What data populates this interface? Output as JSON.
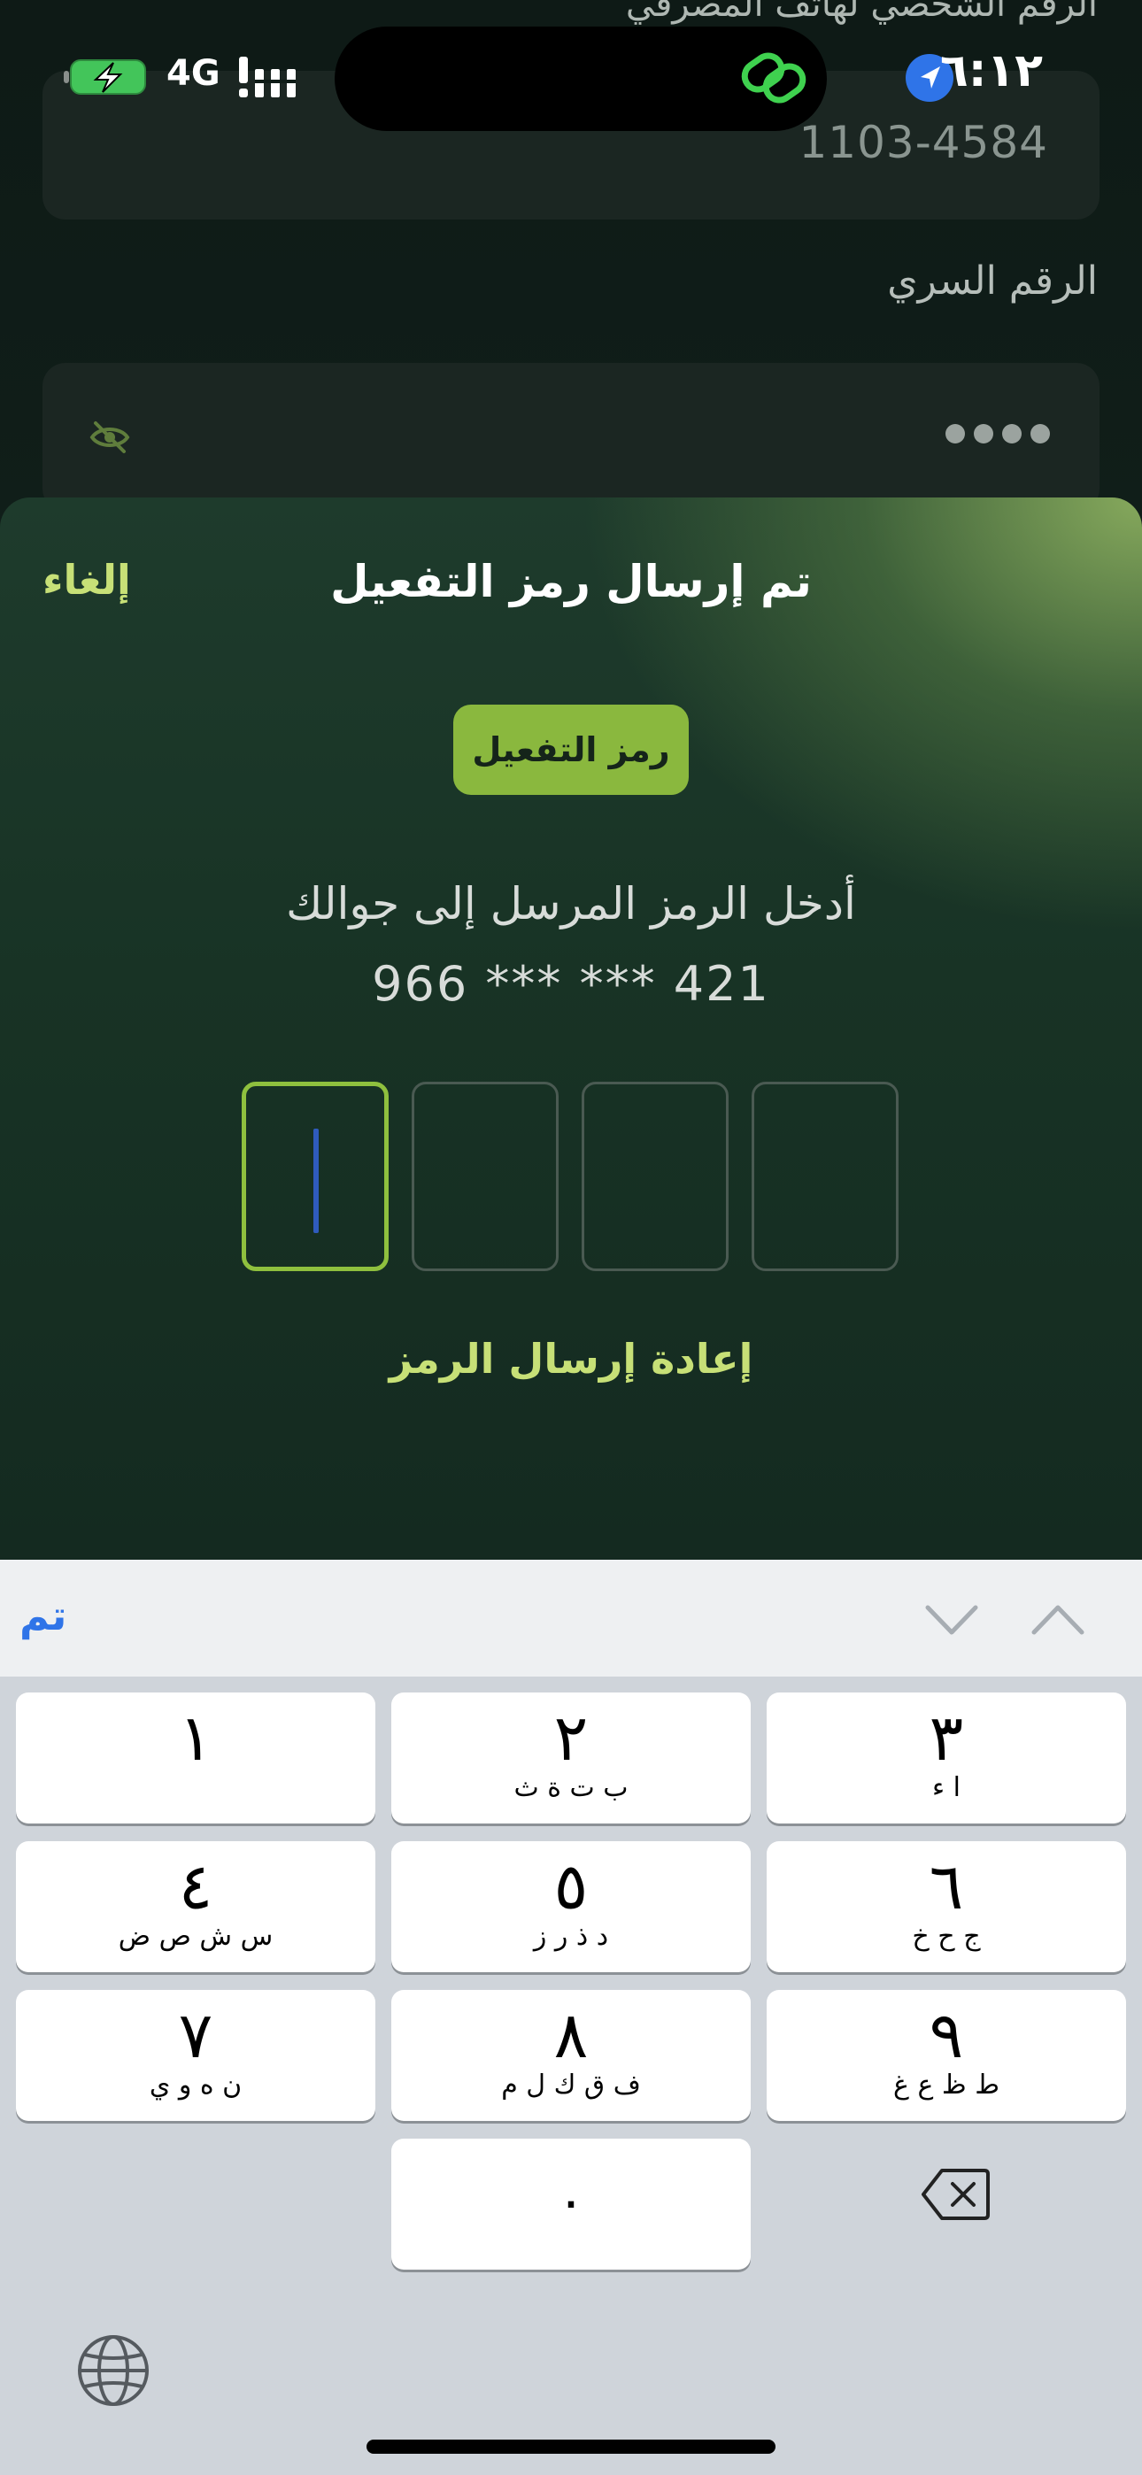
{
  "status_bar": {
    "time": "٦:١٢",
    "network": "4G"
  },
  "background_form": {
    "top_label": "الرقم الشخصي لهاتف المصرفي",
    "account_value": "1103-4584",
    "pin_label": "الرقم السري",
    "pin_dots_count": 4
  },
  "sheet": {
    "title": "تم إرسال رمز التفعيل",
    "cancel_label": "إلغاء",
    "badge_label": "رمز التفعيل",
    "instruction": "أدخل الرمز المرسل إلى جوالك",
    "masked_phone": "966 *** *** 421",
    "otp_box_count": 4,
    "resend_label": "إعادة إرسال الرمز",
    "accent_color": "#8ab83e"
  },
  "keyboard": {
    "done_label": "تم",
    "keys": [
      {
        "num": "١",
        "letters": ""
      },
      {
        "num": "٢",
        "letters": "ب ت ة ث"
      },
      {
        "num": "٣",
        "letters": "ا ء"
      },
      {
        "num": "٤",
        "letters": "س ش ص ض"
      },
      {
        "num": "٥",
        "letters": "د ذ ر ز"
      },
      {
        "num": "٦",
        "letters": "ج ح خ"
      },
      {
        "num": "٧",
        "letters": "ن ه و ي"
      },
      {
        "num": "٨",
        "letters": "ف ق ك ل م"
      },
      {
        "num": "٩",
        "letters": "ط ظ ع غ"
      },
      {
        "num": "٠",
        "letters": ""
      }
    ]
  }
}
